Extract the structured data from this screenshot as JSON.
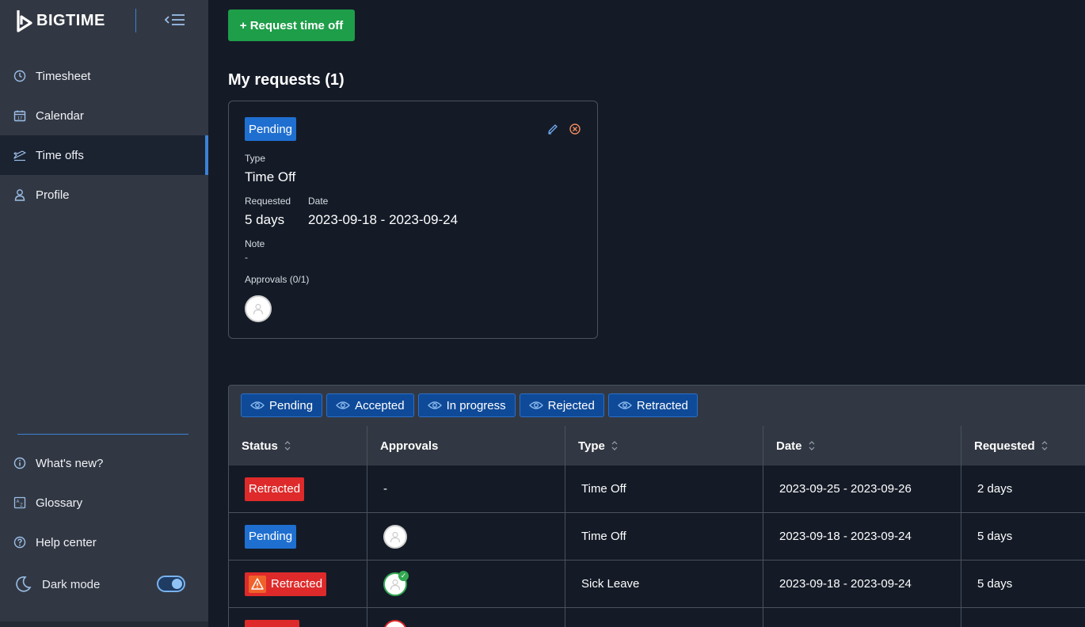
{
  "app": {
    "logo_text": "BIGTIME"
  },
  "sidebar": {
    "items": [
      {
        "label": "Timesheet",
        "icon": "clock-icon"
      },
      {
        "label": "Calendar",
        "icon": "calendar-icon"
      },
      {
        "label": "Time offs",
        "icon": "plane-icon",
        "active": true
      },
      {
        "label": "Profile",
        "icon": "user-icon"
      }
    ],
    "bottom_items": [
      {
        "label": "What's new?",
        "icon": "info-icon"
      },
      {
        "label": "Glossary",
        "icon": "glossary-icon"
      },
      {
        "label": "Help center",
        "icon": "help-icon"
      }
    ],
    "dark_mode_label": "Dark mode",
    "dark_mode_on": true
  },
  "main": {
    "request_button": "+ Request time off",
    "my_requests_title": "My requests (1)",
    "card": {
      "status": "Pending",
      "type_label": "Type",
      "type_value": "Time Off",
      "requested_label": "Requested",
      "requested_value": "5 days",
      "date_label": "Date",
      "date_value": "2023-09-18 - 2023-09-24",
      "note_label": "Note",
      "note_value": "-",
      "approvals_label": "Approvals (0/1)"
    },
    "filters": [
      "Pending",
      "Accepted",
      "In progress",
      "Rejected",
      "Retracted"
    ],
    "table": {
      "columns": [
        "Status",
        "Approvals",
        "Type",
        "Date",
        "Requested"
      ],
      "rows": [
        {
          "status": "Retracted",
          "approvals": "-",
          "type": "Time Off",
          "date": "2023-09-25 - 2023-09-26",
          "requested": "2 days"
        },
        {
          "status": "Pending",
          "approvals": "",
          "type": "Time Off",
          "date": "2023-09-18 - 2023-09-24",
          "requested": "5 days"
        },
        {
          "status": "Retracted",
          "approvals": "",
          "type": "Sick Leave",
          "date": "2023-09-18 - 2023-09-24",
          "requested": "5 days"
        }
      ]
    }
  },
  "colors": {
    "accent": "#3b82d6",
    "success": "#1e9e49",
    "pending": "#1f6fd0",
    "retracted": "#de2a2a"
  }
}
